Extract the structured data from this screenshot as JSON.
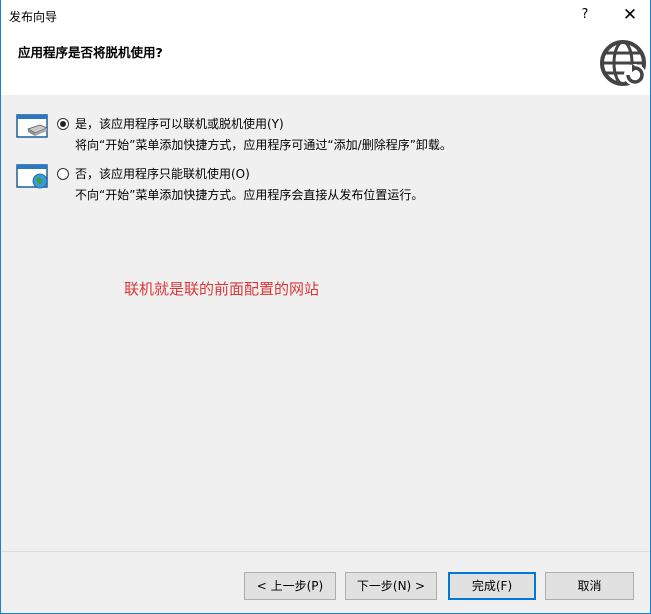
{
  "window": {
    "title": "发布向导",
    "help_glyph": "?",
    "close_glyph": "✕"
  },
  "header": {
    "title": "应用程序是否将脱机使用?",
    "icon": "globe-refresh-icon"
  },
  "options": [
    {
      "label": "是，该应用程序可以联机或脱机使用(Y)",
      "description": "将向“开始”菜单添加快捷方式，应用程序可通过“添加/删除程序”卸载。",
      "checked": true,
      "icon": "drive-window-icon"
    },
    {
      "label": "否，该应用程序只能联机使用(O)",
      "description": "不向“开始”菜单添加快捷方式。应用程序会直接从发布位置运行。",
      "checked": false,
      "icon": "globe-window-icon"
    }
  ],
  "annotation": "联机就是联的前面配置的网站",
  "buttons": {
    "prev": "< 上一步(P)",
    "next": "下一步(N) >",
    "finish": "完成(F)",
    "cancel": "取消"
  },
  "colors": {
    "accent": "#0078d7",
    "annotation": "#d9383a",
    "content_bg": "#f0f0f0"
  }
}
